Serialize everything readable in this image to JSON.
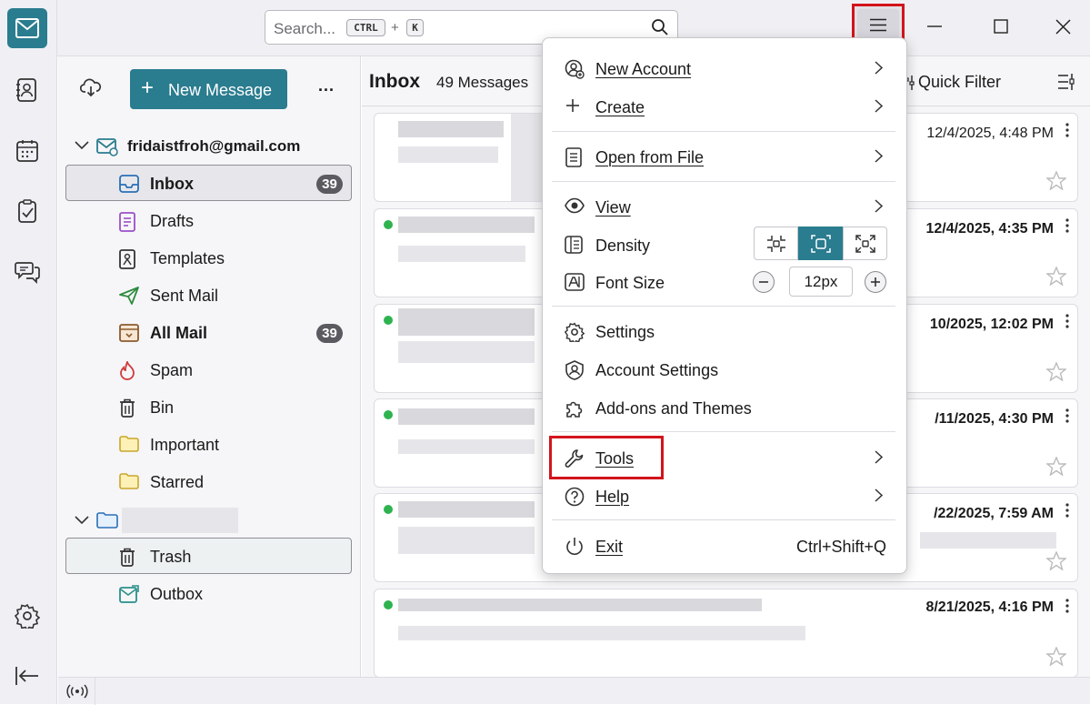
{
  "search": {
    "placeholder": "Search...",
    "key1": "CTRL",
    "plus": "+",
    "key2": "K"
  },
  "colors": {
    "accent": "#2a7c8f",
    "unread_dot": "#2eb34f",
    "highlight": "#d3141c"
  },
  "folder_pane": {
    "new_message": "New Message",
    "more": "...",
    "account": "fridaistfroh@gmail.com",
    "folders": [
      {
        "label": "Inbox",
        "badge": "39",
        "icon": "inbox-icon"
      },
      {
        "label": "Drafts",
        "icon": "drafts-icon"
      },
      {
        "label": "Templates",
        "icon": "templates-icon"
      },
      {
        "label": "Sent Mail",
        "icon": "sent-icon"
      },
      {
        "label": "All Mail",
        "badge": "39",
        "icon": "archive-icon"
      },
      {
        "label": "Spam",
        "icon": "spam-icon"
      },
      {
        "label": "Bin",
        "icon": "bin-icon"
      },
      {
        "label": "Important",
        "icon": "folder-icon"
      },
      {
        "label": "Starred",
        "icon": "folder-icon"
      }
    ],
    "local_folders": [
      {
        "label": "Trash",
        "icon": "trash-icon"
      },
      {
        "label": "Outbox",
        "icon": "outbox-icon"
      }
    ]
  },
  "thread_pane": {
    "title": "Inbox",
    "count": "49 Messages",
    "quick_filter": "Quick Filter",
    "messages": [
      {
        "date": "12/4/2025, 4:48 PM",
        "unread": false
      },
      {
        "date": "12/4/2025, 4:35 PM",
        "unread": true
      },
      {
        "date": "10/2025, 12:02 PM",
        "unread": true
      },
      {
        "date": "/11/2025, 4:30 PM",
        "unread": true
      },
      {
        "date": "/22/2025, 7:59 AM",
        "unread": true
      },
      {
        "date": "8/21/2025, 4:16 PM",
        "unread": true
      }
    ]
  },
  "app_menu": {
    "new_account": "New Account",
    "create": "Create",
    "open_from_file": "Open from File",
    "view": "View",
    "density": "Density",
    "font_size": "Font Size",
    "font_size_value": "12px",
    "settings": "Settings",
    "account_settings": "Account Settings",
    "addons": "Add-ons and Themes",
    "tools": "Tools",
    "help": "Help",
    "exit": "Exit",
    "exit_shortcut": "Ctrl+Shift+Q"
  }
}
